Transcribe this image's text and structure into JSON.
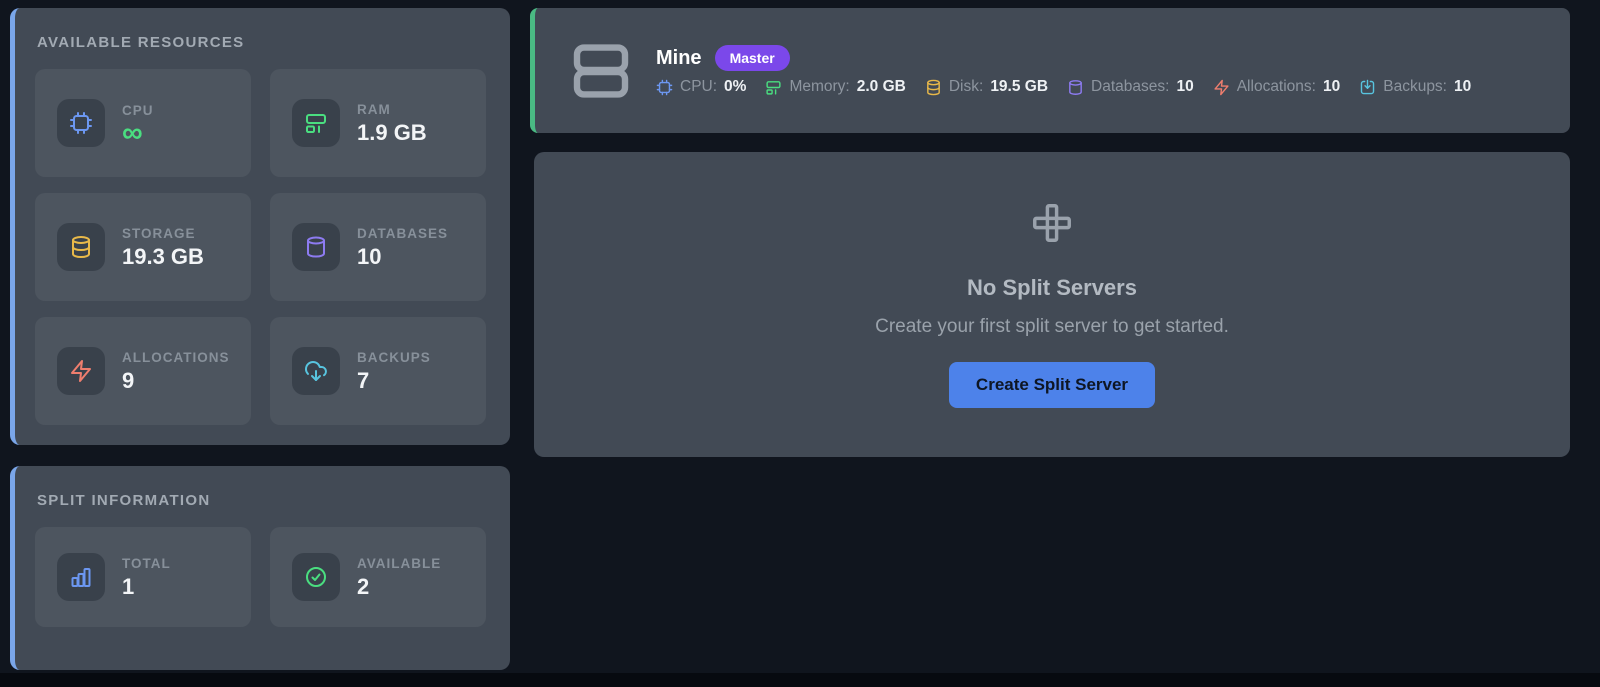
{
  "resources_panel": {
    "title": "AVAILABLE RESOURCES",
    "cards": [
      {
        "label": "CPU",
        "value": "∞",
        "icon": "cpu-icon"
      },
      {
        "label": "RAM",
        "value": "1.9 GB",
        "icon": "ram-icon"
      },
      {
        "label": "STORAGE",
        "value": "19.3 GB",
        "icon": "storage-icon"
      },
      {
        "label": "DATABASES",
        "value": "10",
        "icon": "database-icon"
      },
      {
        "label": "ALLOCATIONS",
        "value": "9",
        "icon": "lightning-icon"
      },
      {
        "label": "BACKUPS",
        "value": "7",
        "icon": "cloud-download-icon"
      }
    ]
  },
  "split_panel": {
    "title": "SPLIT INFORMATION",
    "cards": [
      {
        "label": "TOTAL",
        "value": "1",
        "icon": "bar-chart-icon"
      },
      {
        "label": "AVAILABLE",
        "value": "2",
        "icon": "check-circle-icon"
      }
    ]
  },
  "server_card": {
    "name": "Mine",
    "badge": "Master",
    "stats": [
      {
        "label": "CPU:",
        "value": "0%",
        "icon": "cpu-icon"
      },
      {
        "label": "Memory:",
        "value": "2.0 GB",
        "icon": "ram-icon"
      },
      {
        "label": "Disk:",
        "value": "19.5 GB",
        "icon": "storage-icon"
      },
      {
        "label": "Databases:",
        "value": "10",
        "icon": "database-icon"
      },
      {
        "label": "Allocations:",
        "value": "10",
        "icon": "lightning-icon"
      },
      {
        "label": "Backups:",
        "value": "10",
        "icon": "box-download-icon"
      }
    ]
  },
  "empty_state": {
    "title": "No Split Servers",
    "subtitle": "Create your first split server to get started.",
    "button_label": "Create Split Server"
  },
  "colors": {
    "page_bg": "#10151e",
    "panel_bg": "#424a55",
    "card_bg": "#4d555f",
    "icon_box_bg": "#39414b",
    "accent_blue_border": "#7aa6e9",
    "accent_green_border": "#4aba83",
    "badge_purple": "#7b48ea",
    "button_blue": "#4d82ea",
    "icon_blue": "#6c97f1",
    "icon_green": "#4ade80",
    "icon_yellow": "#e9b949",
    "icon_purple": "#8d7bf1",
    "icon_salmon": "#ef7e6e",
    "icon_cyan": "#58c4df"
  }
}
